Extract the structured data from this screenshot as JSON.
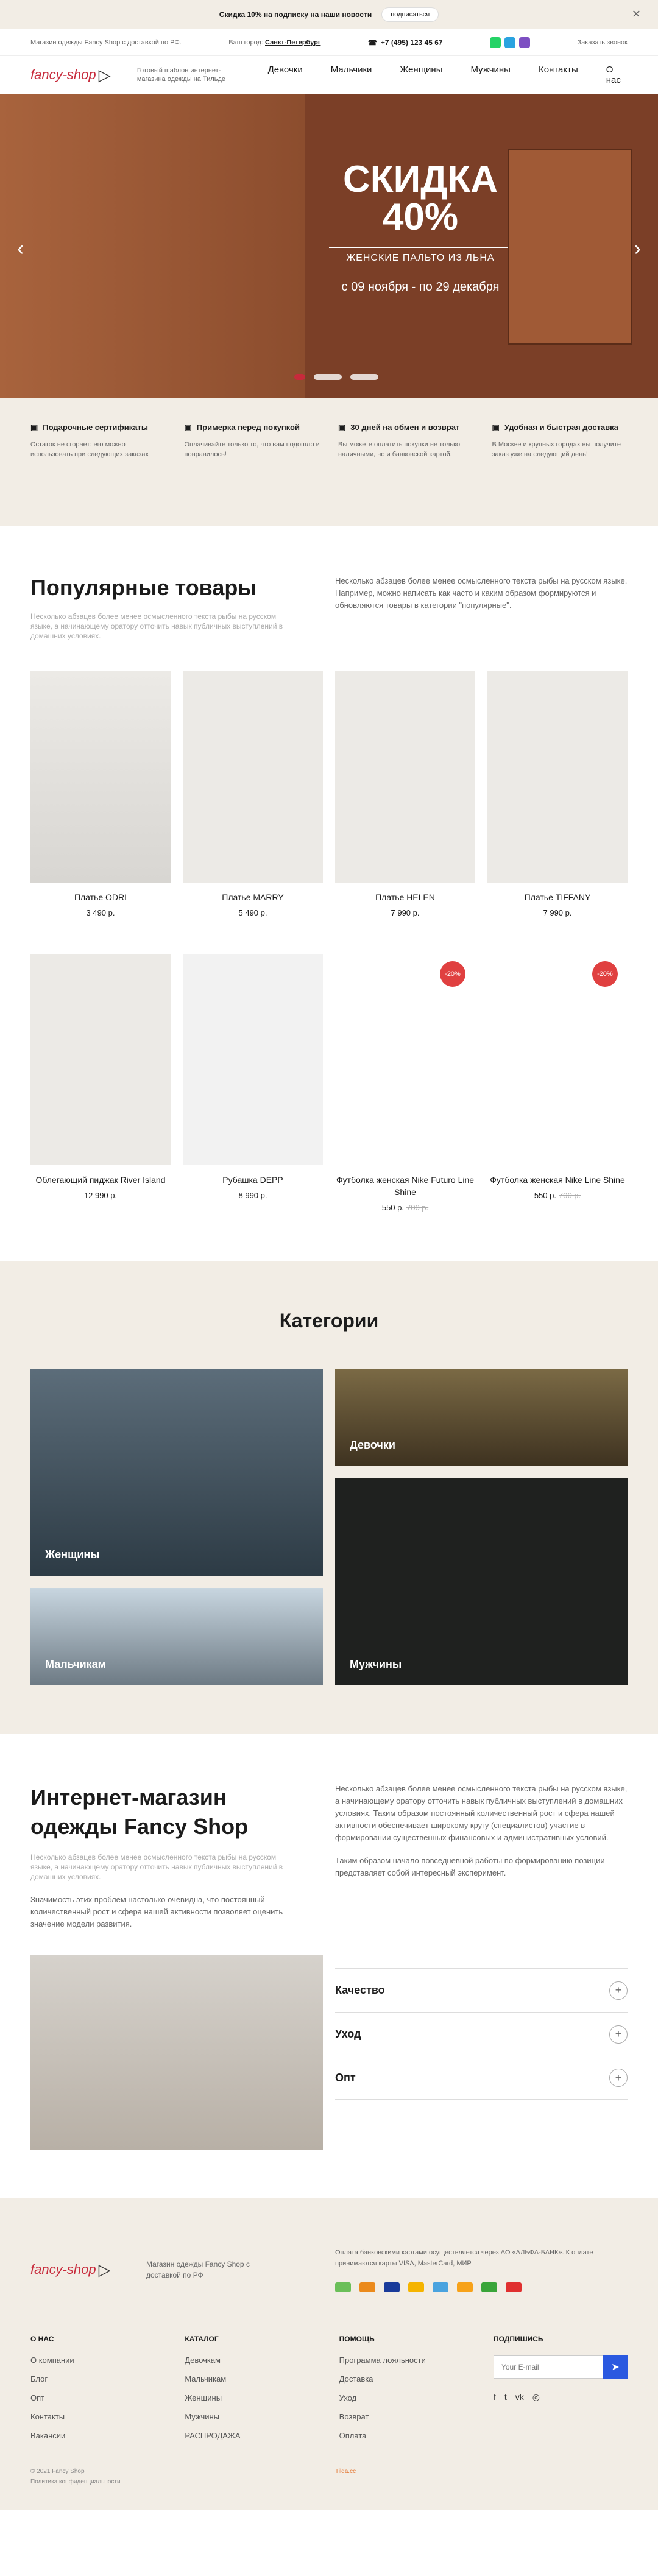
{
  "promo": {
    "text": "Скидка 10% на подписку на наши новости",
    "btn": "подписаться"
  },
  "top": {
    "info": "Магазин одежды Fancy Shop с доставкой по РФ.",
    "city_label": "Ваш город:",
    "city": "Санкт-Петербург",
    "phone": "+7 (495) 123 45 67",
    "callback": "Заказать звонок"
  },
  "header": {
    "logo": "fancy-shop",
    "tagline": "Готовый шаблон интернет-магазина одежды на Тильде",
    "menu": [
      "Девочки",
      "Мальчики",
      "Женщины",
      "Мужчины",
      "Контакты",
      "О нас"
    ]
  },
  "hero": {
    "title1": "СКИДКА",
    "title2": "40%",
    "subtitle": "ЖЕНСКИЕ ПАЛЬТО ИЗ ЛЬНА",
    "dates": "с 09 ноября - по 29 декабря"
  },
  "features": [
    {
      "title": "Подарочные сертификаты",
      "text": "Остаток не сгорает: его можно использовать при следующих заказах"
    },
    {
      "title": "Примерка перед покупкой",
      "text": "Оплачивайте только то, что вам подошло и понравилось!"
    },
    {
      "title": "30 дней на обмен и возврат",
      "text": "Вы можете оплатить покупки не только наличными, но и банковской картой."
    },
    {
      "title": "Удобная и быстрая доставка",
      "text": "В Москве и крупных городах вы получите заказ уже на следующий день!"
    }
  ],
  "popular": {
    "title": "Популярные товары",
    "muted": "Несколько абзацев более менее осмысленного текста рыбы на русском языке, а начинающему оратору отточить навык публичных выступлений в домашних условиях.",
    "lede": "Несколько абзацев более менее осмысленного текста рыбы на русском языке. Например, можно написать как часто и каким образом формируются и обновляются товары в категории \"популярные\"."
  },
  "products": [
    {
      "name": "Платье ODRI",
      "price": "3 490 р.",
      "old": ""
    },
    {
      "name": "Платье MARRY",
      "price": "5 490 р.",
      "old": ""
    },
    {
      "name": "Платье HELEN",
      "price": "7 990 р.",
      "old": ""
    },
    {
      "name": "Платье TIFFANY",
      "price": "7 990 р.",
      "old": ""
    },
    {
      "name": "Облегающий пиджак River Island",
      "price": "12 990 р.",
      "old": ""
    },
    {
      "name": "Рубашка DEPP",
      "price": "8 990 р.",
      "old": ""
    },
    {
      "name": "Футболка женская Nike Futuro Line Shine",
      "price": "550 р.",
      "old": "700 р.",
      "badge": "-20%"
    },
    {
      "name": "Футболка женская Nike Line Shine",
      "price": "550 р.",
      "old": "700 р.",
      "badge": "-20%"
    }
  ],
  "categories": {
    "title": "Категории",
    "items": [
      "Женщины",
      "Девочки",
      "Мальчикам",
      "Мужчины"
    ]
  },
  "about": {
    "title": "Интернет-магазин одежды Fancy Shop",
    "muted": "Несколько абзацев более менее осмысленного текста рыбы на русском языке, а начинающему оратору отточить навык публичных выступлений в домашних условиях.",
    "text": "Значимость этих проблем настолько очевидна, что постоянный количественный рост и сфера нашей активности позволяет оценить значение модели развития.",
    "r1": "Несколько абзацев более менее осмысленного текста рыбы на русском языке, а начинающему оратору отточить навык публичных выступлений в домашних условиях. Таким образом постоянный количественный рост и сфера нашей активности обеспечивает широкому кругу (специалистов) участие в формировании существенных финансовых и административных условий.",
    "r2": "Таким образом начало повседневной работы по формированию позиции представляет собой интересный эксперимент.",
    "acc": [
      "Качество",
      "Уход",
      "Опт"
    ]
  },
  "footer": {
    "shop": "Магазин одежды Fancy Shop с доставкой по РФ",
    "pay": "Оплата банковскими картами осуществляется через АО «АЛЬФА-БАНК». К оплате принимаются карты VISA, MasterCard, МИР",
    "cols": [
      {
        "h": "О НАС",
        "items": [
          "О компании",
          "Блог",
          "Опт",
          "Контакты",
          "Вакансии"
        ]
      },
      {
        "h": "КАТАЛОГ",
        "items": [
          "Девочкам",
          "Мальчикам",
          "Женщины",
          "Мужчины",
          "РАСПРОДАЖА"
        ]
      },
      {
        "h": "ПОМОЩЬ",
        "items": [
          "Программа лояльности",
          "Доставка",
          "Уход",
          "Возврат",
          "Оплата"
        ]
      },
      {
        "h": "ПОДПИШИСЬ",
        "items": []
      }
    ],
    "email_ph": "Your E-mail",
    "copy": "© 2021 Fancy Shop",
    "policy": "Политика конфиденциальности",
    "made": "Tilda.cc"
  }
}
